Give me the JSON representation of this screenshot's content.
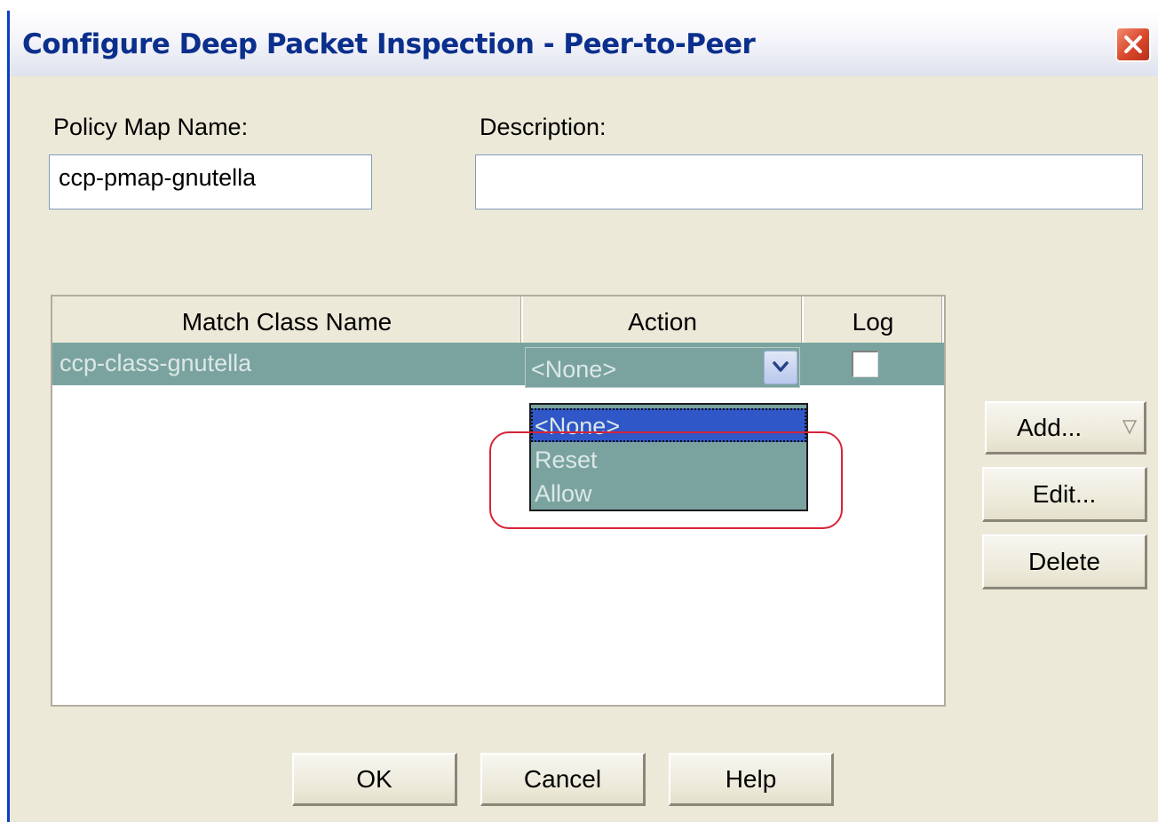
{
  "window": {
    "title": "Configure Deep Packet Inspection - Peer-to-Peer"
  },
  "form": {
    "policy_map_label": "Policy Map Name:",
    "policy_map_value": "ccp-pmap-gnutella",
    "description_label": "Description:",
    "description_value": ""
  },
  "table": {
    "columns": [
      "Match Class Name",
      "Action",
      "Log"
    ],
    "rows": [
      {
        "match_class": "ccp-class-gnutella",
        "action": "<None>",
        "log": false
      }
    ]
  },
  "action_dropdown": {
    "options": [
      "<None>",
      "Reset",
      "Allow"
    ],
    "selected": "<None>"
  },
  "side_buttons": {
    "add": "Add...",
    "edit": "Edit...",
    "delete": "Delete"
  },
  "footer_buttons": {
    "ok": "OK",
    "cancel": "Cancel",
    "help": "Help"
  },
  "icons": {
    "close": "close-icon",
    "combo_arrow": "chevron-down-icon",
    "add_menu": "triangle-down-icon"
  },
  "colors": {
    "title_text": "#0b2f8c",
    "selected_row": "#7aa3a0",
    "dropdown_selected": "#2f57c8",
    "highlight_oval": "#d6243a",
    "dialog_bg": "#ece9d8"
  }
}
